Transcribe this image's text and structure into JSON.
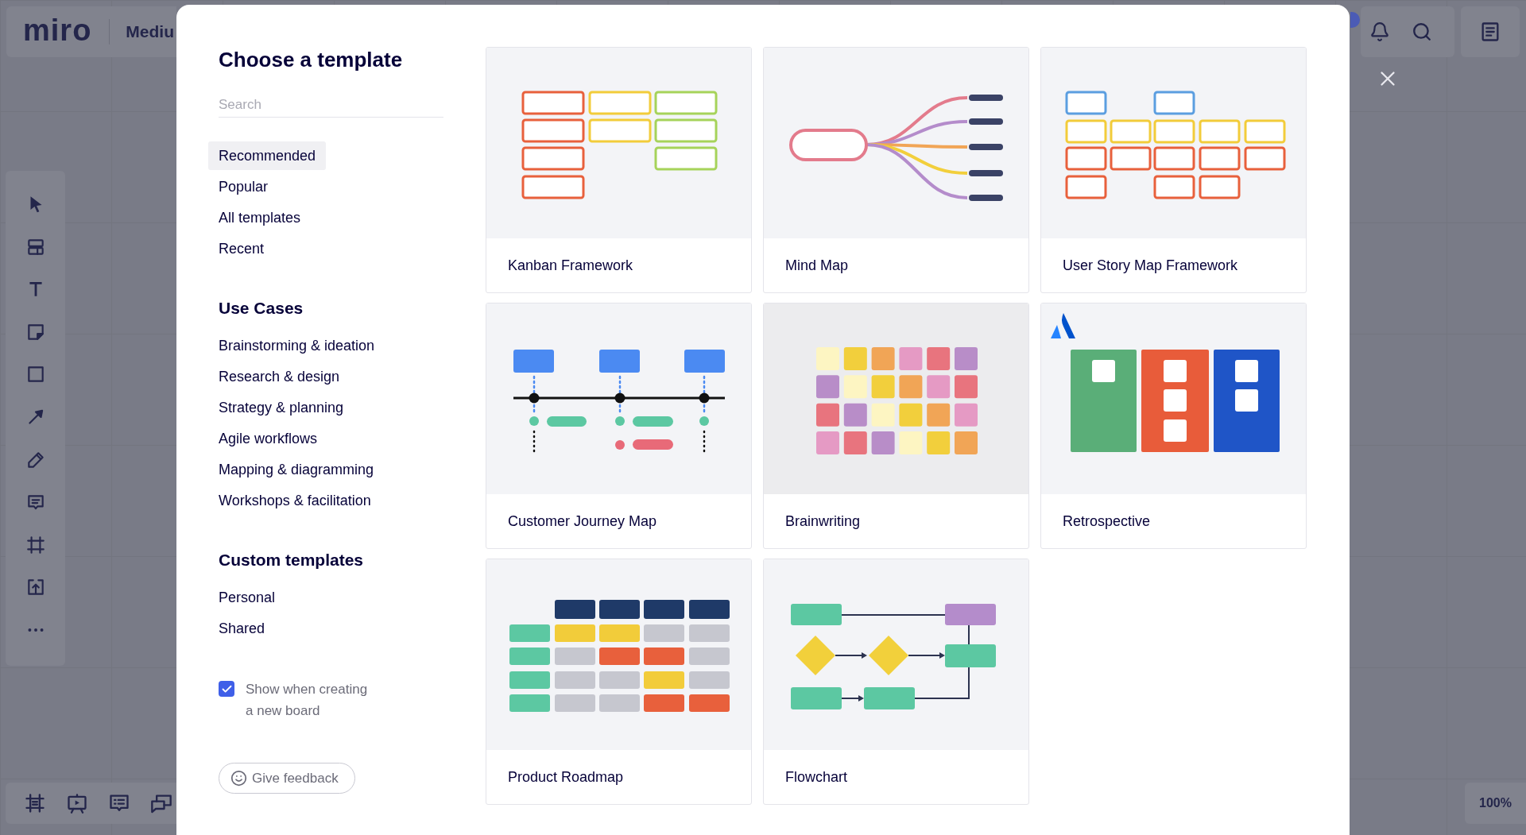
{
  "header": {
    "logo": "miro",
    "board_name": "Mediu"
  },
  "zoom": {
    "label": "100%"
  },
  "dialog": {
    "title": "Choose a template",
    "search": {
      "placeholder": "Search"
    },
    "nav": [
      {
        "label": "Recommended",
        "selected": true
      },
      {
        "label": "Popular",
        "selected": false
      },
      {
        "label": "All templates",
        "selected": false
      },
      {
        "label": "Recent",
        "selected": false
      }
    ],
    "sections": [
      {
        "heading": "Use Cases",
        "items": [
          {
            "label": "Brainstorming & ideation",
            "selected": false
          },
          {
            "label": "Research & design",
            "selected": false
          },
          {
            "label": "Strategy & planning",
            "selected": false
          },
          {
            "label": "Agile workflows",
            "selected": false
          },
          {
            "label": "Mapping & diagramming",
            "selected": false
          },
          {
            "label": "Workshops & facilitation",
            "selected": false
          }
        ]
      },
      {
        "heading": "Custom templates",
        "items": [
          {
            "label": "Personal",
            "selected": false
          },
          {
            "label": "Shared",
            "selected": false
          }
        ]
      }
    ],
    "show_option": {
      "label": "Show when creating a new board",
      "checked": true
    },
    "feedback_button": {
      "label": "Give feedback"
    },
    "templates": [
      {
        "name": "Kanban Framework",
        "kind": "kanban"
      },
      {
        "name": "Mind Map",
        "kind": "mindmap"
      },
      {
        "name": "User Story Map Framework",
        "kind": "storymap"
      },
      {
        "name": "Customer Journey Map",
        "kind": "journey"
      },
      {
        "name": "Brainwriting",
        "kind": "brainwriting"
      },
      {
        "name": "Retrospective",
        "kind": "retrospective"
      },
      {
        "name": "Product Roadmap",
        "kind": "roadmap"
      },
      {
        "name": "Flowchart",
        "kind": "flowchart"
      }
    ]
  }
}
